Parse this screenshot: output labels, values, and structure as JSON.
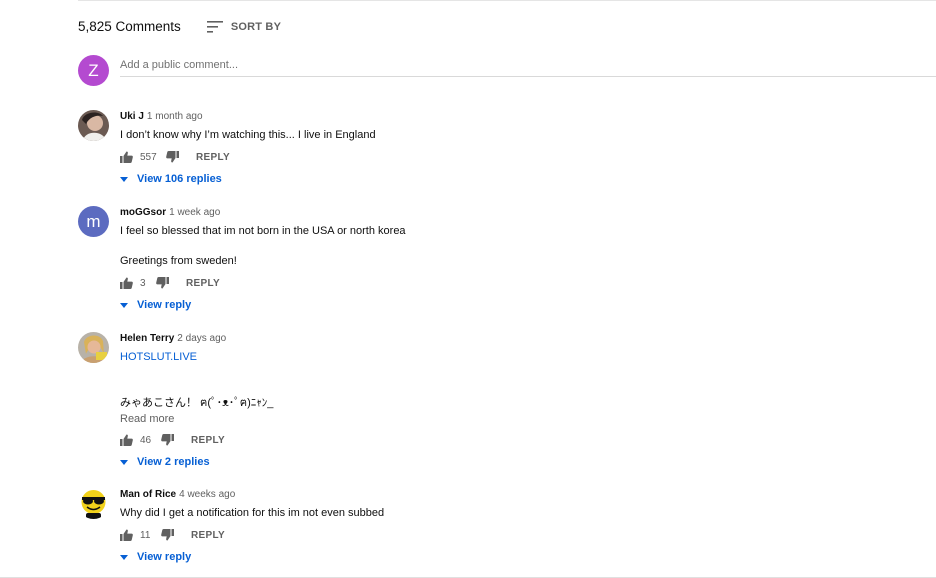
{
  "header": {
    "count_label": "5,825 Comments",
    "sort_label": "SORT BY"
  },
  "add_comment": {
    "avatar_letter": "Z",
    "placeholder": "Add a public comment..."
  },
  "colors": {
    "link": "#065fd4",
    "muted": "#606060",
    "my_avatar": "#b44ad0",
    "letter_avatar": "#5c6bc0"
  },
  "comments": [
    {
      "author": "Uki J",
      "time": "1 month ago",
      "text": "I don’t know why I’m watching this... I live in England",
      "likes": "557",
      "reply_label": "REPLY",
      "view_label": "View 106 replies"
    },
    {
      "author": "moGGsor",
      "avatar_letter": "m",
      "time": "1 week ago",
      "text": "I feel so blessed that im not born in the USA or north korea",
      "text2": "Greetings from sweden!",
      "likes": "3",
      "reply_label": "REPLY",
      "view_label": "View reply"
    },
    {
      "author": "Helen Terry",
      "time": "2 days ago",
      "link_text": "HOTSLUT.LIVE",
      "text": "みゃあこさん！ ฅ(ﾟ･ᴥ･ﾟฅ)ﾆｬﾝ_",
      "read_more": "Read more",
      "likes": "46",
      "reply_label": "REPLY",
      "view_label": "View 2 replies"
    },
    {
      "author": "Man of Rice",
      "time": "4 weeks ago",
      "text": "Why did I get a notification for this im not even subbed",
      "likes": "11",
      "reply_label": "REPLY",
      "view_label": "View reply"
    }
  ]
}
